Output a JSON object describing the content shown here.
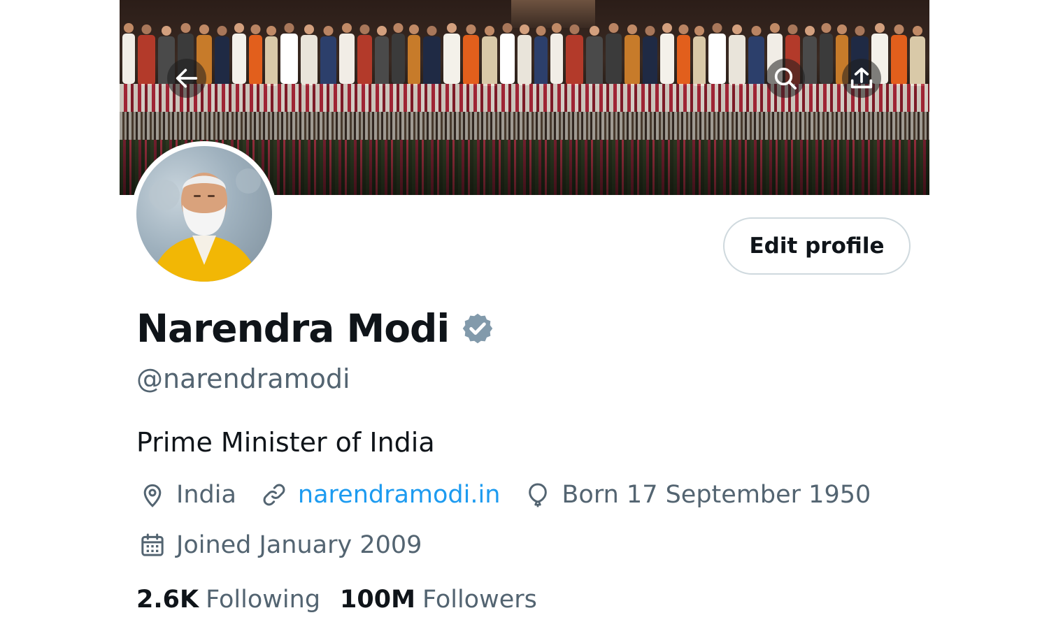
{
  "profile": {
    "name": "Narendra Modi",
    "handle": "@narendramodi",
    "bio": "Prime Minister of India",
    "location": "India",
    "website": "narendramodi.in",
    "birthday": "Born 17 September 1950",
    "joined": "Joined January 2009",
    "following_count": "2.6K",
    "following_label": "Following",
    "followers_count": "100M",
    "followers_label": "Followers",
    "verified": true
  },
  "actions": {
    "edit_profile_label": "Edit profile"
  },
  "icons": {
    "back": "arrow-left-icon",
    "search": "search-icon",
    "share": "share-icon",
    "location": "location-pin-icon",
    "link": "link-icon",
    "birthday": "balloon-icon",
    "joined": "calendar-icon",
    "verified": "verified-badge-icon"
  },
  "colors": {
    "link": "#1d9bf0",
    "text_primary": "#0f1419",
    "text_secondary": "#536471",
    "verified_badge": "#829aab",
    "button_border": "#cfd9de"
  }
}
